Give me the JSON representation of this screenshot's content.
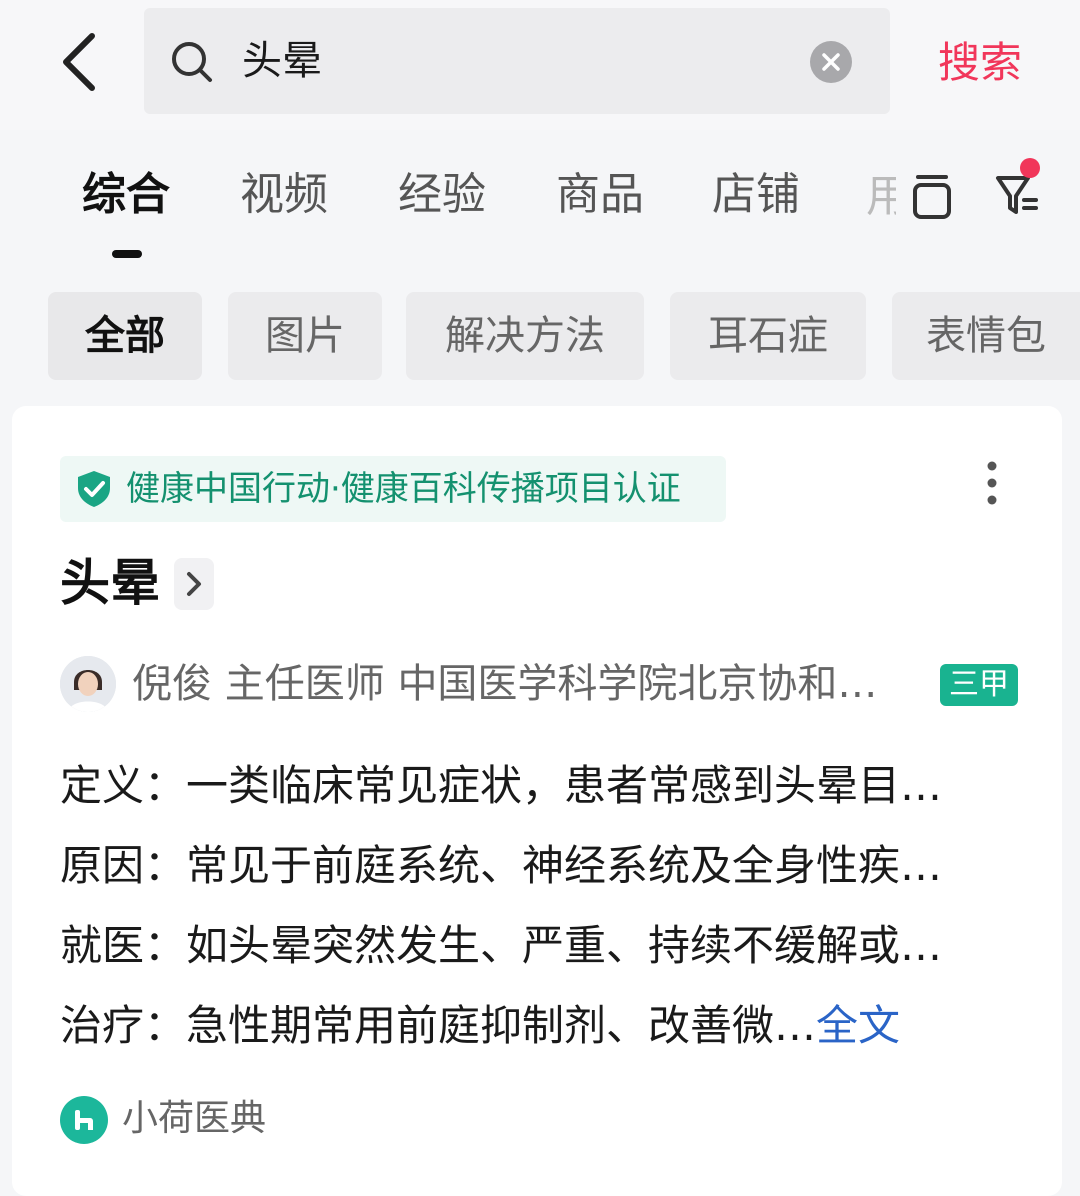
{
  "search": {
    "query": "头晕",
    "submit_label": "搜索"
  },
  "tabs": [
    {
      "label": "综合",
      "active": true
    },
    {
      "label": "视频"
    },
    {
      "label": "经验"
    },
    {
      "label": "商品"
    },
    {
      "label": "店铺"
    }
  ],
  "tab_overflow_glyph": "用",
  "chips": [
    {
      "label": "全部",
      "active": true
    },
    {
      "label": "图片"
    },
    {
      "label": "解决方法"
    },
    {
      "label": "耳石症"
    },
    {
      "label": "表情包"
    }
  ],
  "card": {
    "certification": "健康中国行动·健康百科传播项目认证",
    "title": "头晕",
    "author": {
      "name": "倪俊",
      "title": "主任医师",
      "hospital": "中国医学科学院北京协和…",
      "badge": "三甲"
    },
    "rows": [
      {
        "label": "定义：",
        "value": "一类临床常见症状，患者常感到头晕目…"
      },
      {
        "label": "原因：",
        "value": "常见于前庭系统、神经系统及全身性疾…"
      },
      {
        "label": "就医：",
        "value": "如头晕突然发生、严重、持续不缓解或…"
      },
      {
        "label": "治疗：",
        "value": "急性期常用前庭抑制剂、改善微…",
        "link": "全文"
      }
    ],
    "source": "小荷医典"
  },
  "colors": {
    "accent": "#f1365a",
    "cert_green": "#14916f",
    "badge_green": "#19b390",
    "link_blue": "#2a64c7"
  }
}
